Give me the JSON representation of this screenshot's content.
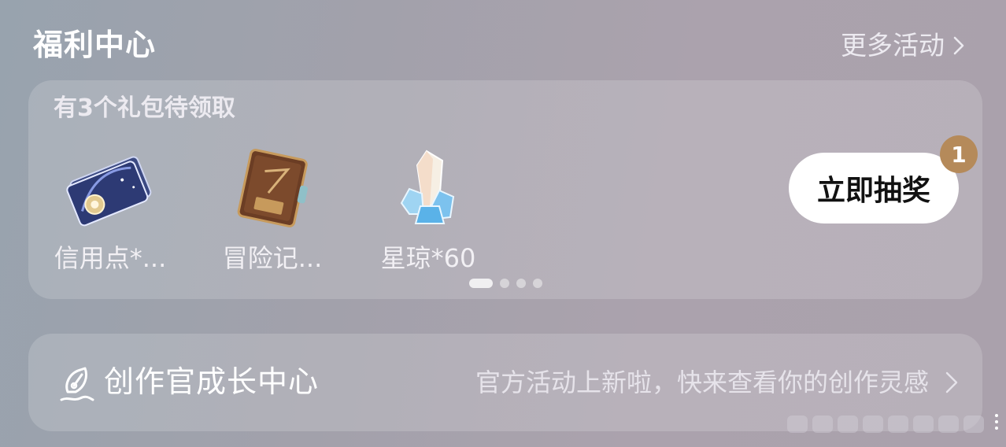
{
  "header": {
    "title": "福利中心",
    "more_label": "更多活动"
  },
  "gift_panel": {
    "subtitle": "有3个礼包待领取",
    "items": [
      {
        "icon": "credit-card-icon",
        "label": "信用点*..."
      },
      {
        "icon": "journal-book-icon",
        "label": "冒险记..."
      },
      {
        "icon": "crystal-icon",
        "label": "星琼*60"
      }
    ],
    "pagination": {
      "current": 1,
      "total": 4
    },
    "draw_button_label": "立即抽奖",
    "draw_badge_count": "1"
  },
  "creator_card": {
    "title": "创作官成长中心",
    "description": "官方活动上新啦，快来查看你的创作灵感"
  },
  "colors": {
    "badge": "#b58a5a",
    "button_bg": "#ffffff"
  }
}
